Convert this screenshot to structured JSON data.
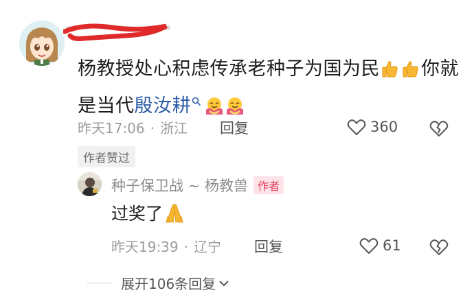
{
  "comment": {
    "text_part1": "杨教授处心积虑传承老种子为国为民",
    "text_part2": "你就是当代",
    "mention": "殷汝耕",
    "time": "昨天17:06",
    "location": "浙江",
    "reply_label": "回复",
    "like_count": "360",
    "author_liked_tag": "作者赞过"
  },
  "reply": {
    "username": "种子保卫战 ~ 杨教兽",
    "author_badge": "作者",
    "text": "过奖了",
    "time": "昨天19:39",
    "location": "辽宁",
    "reply_label": "回复",
    "like_count": "61"
  },
  "expand": {
    "label": "展开106条回复"
  },
  "colors": {
    "mention": "#2f5fa8",
    "author_badge_bg": "#fde3e7",
    "author_badge_text": "#e23a5b",
    "redaction": "#e02a2a"
  },
  "icons": {
    "thumbs_up": "thumbs-up-emoji",
    "hug": "hug-emoji",
    "search": "search-icon",
    "pray": "pray-emoji",
    "heart": "heart-outline-icon",
    "dislike": "broken-heart-icon",
    "chevron": "chevron-down-icon"
  }
}
